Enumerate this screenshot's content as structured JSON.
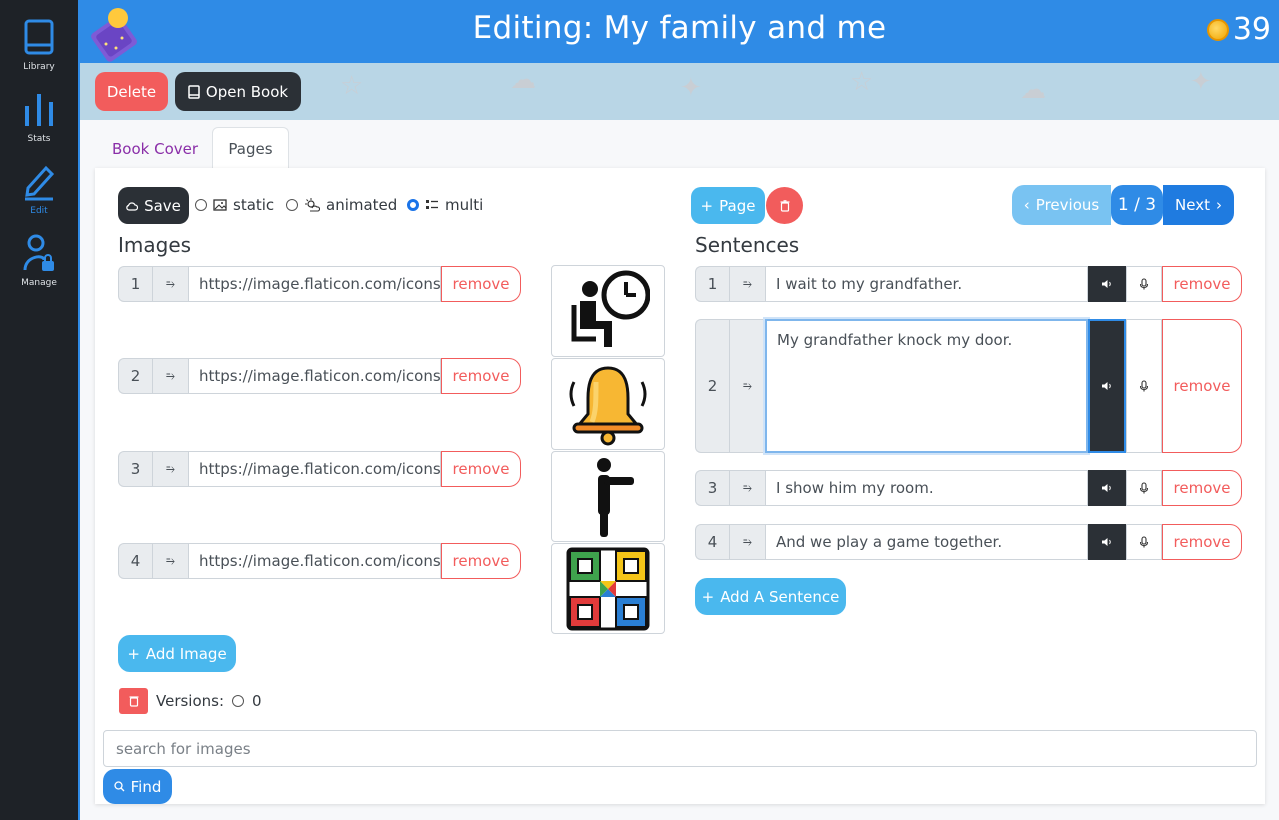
{
  "sidebar": {
    "items": [
      {
        "label": "Library",
        "icon": "book-icon"
      },
      {
        "label": "Stats",
        "icon": "bar-chart-icon"
      },
      {
        "label": "Edit",
        "icon": "pencil-icon"
      },
      {
        "label": "Manage",
        "icon": "user-lock-icon"
      }
    ],
    "active": "Edit"
  },
  "header": {
    "title": "Editing: My family and me",
    "coins": "39"
  },
  "actions": {
    "delete_label": "Delete",
    "open_book_label": "Open Book"
  },
  "tabs": [
    {
      "label": "Book Cover",
      "active": false
    },
    {
      "label": "Pages",
      "active": true
    }
  ],
  "toolbar": {
    "save_label": "Save",
    "modes": [
      {
        "label": "static",
        "selected": false
      },
      {
        "label": "animated",
        "selected": false
      },
      {
        "label": "multi",
        "selected": true
      }
    ],
    "add_page_label": "Page",
    "prev_label": "Previous",
    "page_indicator": "1 / 3",
    "next_label": "Next"
  },
  "images": {
    "heading": "Images",
    "remove_label": "remove",
    "items": [
      {
        "num": "1",
        "url": "https://image.flaticon.com/icons/"
      },
      {
        "num": "2",
        "url": "https://image.flaticon.com/icons"
      },
      {
        "num": "3",
        "url": "https://image.flaticon.com/icons"
      },
      {
        "num": "4",
        "url": "https://image.flaticon.com/icons"
      }
    ],
    "add_label": "Add Image"
  },
  "sentences": {
    "heading": "Sentences",
    "remove_label": "remove",
    "items": [
      {
        "num": "1",
        "text": "I wait to my grandfather."
      },
      {
        "num": "2",
        "text": "My grandfather knock my door."
      },
      {
        "num": "3",
        "text": "I show him my room."
      },
      {
        "num": "4",
        "text": "And we play a game together."
      }
    ],
    "add_label": "Add A Sentence"
  },
  "versions": {
    "label": "Versions:",
    "value": "0"
  },
  "search": {
    "placeholder": "search for images",
    "find_label": "Find"
  },
  "colors": {
    "primary": "#2f8be6",
    "danger": "#f25c5c",
    "info": "#4ab8ee",
    "dark": "#2b3036",
    "tab_link": "#8a2ea8"
  }
}
